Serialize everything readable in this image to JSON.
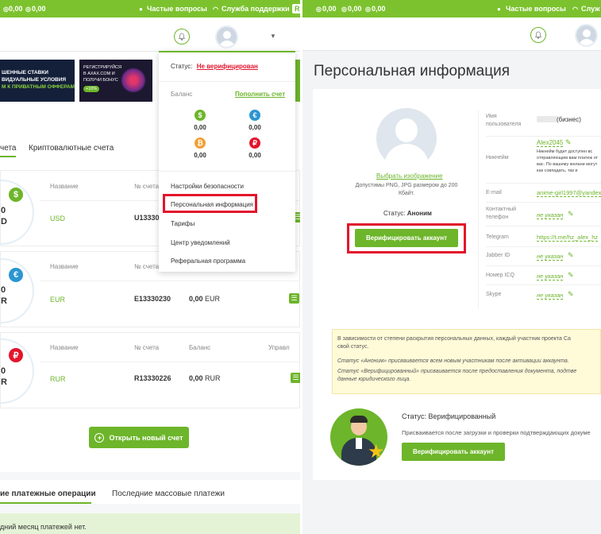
{
  "left": {
    "topbar": {
      "amount1": "0,00",
      "amount2": "0,00",
      "faq": "Частые вопросы",
      "support": "Служба поддержки",
      "lang": "R"
    },
    "banners": {
      "b1_line1": "ШЕННЫЕ СТАВКИ",
      "b1_line2": "ВИДУАЛЬНЫЕ УСЛОВИЯ",
      "b1_line3": "М К ПРИВАТНЫМ ОФФЕРАМ",
      "b2_line1": "РЕГИСТРИРУЙСЯ",
      "b2_line2": "В AXAX.COM И",
      "b2_line3": "ПОЛУЧИ БОНУС",
      "b2_badge": "+10%"
    },
    "tabs": {
      "tab1": "чета",
      "tab2": "Криптовалютные счета"
    },
    "accounts": [
      {
        "symbol": "$",
        "color": "#6db52a",
        "name_label": "Название",
        "acc_label": "№ счета",
        "name": "USD",
        "number": "U13330",
        "balance": "",
        "balance_label": "",
        "side1": "0",
        "side2": "D"
      },
      {
        "symbol": "€",
        "color": "#2b96d1",
        "name_label": "Название",
        "acc_label": "№ счета",
        "name": "EUR",
        "number": "E13330230",
        "balance": "0,00",
        "balance_label": "",
        "currency": "EUR",
        "side1": "0",
        "side2": "R"
      },
      {
        "symbol": "₽",
        "color": "#e2152c",
        "name_label": "Название",
        "acc_label": "№ счета",
        "name": "RUR",
        "number": "R13330226",
        "balance": "0,00",
        "balance_label": "Баланс",
        "currency": "RUR",
        "manage_label": "Управл",
        "side1": "0",
        "side2": "R"
      }
    ],
    "open_account": "Открыть новый счет",
    "bottom_tabs": {
      "tab1": "ие платежные операции",
      "tab2": "Последние массовые платежи"
    },
    "notice": "дний месяц платежей нет.",
    "dropdown": {
      "status_label": "Статус:",
      "status_value": "Не верифицирован",
      "balance_label": "Баланс",
      "topup": "Пополнить счет",
      "balances": [
        {
          "symbol": "$",
          "color": "#6db52a",
          "value": "0,00"
        },
        {
          "symbol": "€",
          "color": "#2b96d1",
          "value": "0,00"
        },
        {
          "symbol": "₿",
          "color": "#f3a034",
          "value": "0,00"
        },
        {
          "symbol": "₽",
          "color": "#e2152c",
          "value": "0,00"
        }
      ],
      "menu": [
        "Настройки безопасности",
        "Персональная информация",
        "Тарифы",
        "Центр уведомлений",
        "Реферальная программа"
      ]
    }
  },
  "right": {
    "topbar": {
      "a1": "0,00",
      "a2": "0,00",
      "a3": "0,00",
      "faq": "Частые вопросы",
      "support": "Служ"
    },
    "title": "Персональная информация",
    "choose_image": "Выбрать изображение",
    "formats": "Допустимы PNG, JPG размером до 200 Кбайт.",
    "status_label": "Статус:",
    "status_value": "Аноним",
    "verify": "Верифицировать аккаунт",
    "fields": [
      {
        "label": "Имя пользователя",
        "value": "(бизнес)"
      },
      {
        "label": "Никнейм",
        "value": "Alex2045",
        "note": "Никнейм будет доступен вс отправляющим вам платеж от вас. По вашему желани могут как совпадать, так и"
      },
      {
        "label": "E-mail",
        "value": "anime-girl1997@yandex.r"
      },
      {
        "label": "Контактный телефон",
        "value": "не указан"
      },
      {
        "label": "Telegram",
        "value": "https://t.me/hz_alex_hz"
      },
      {
        "label": "Jabber ID",
        "value": "не указан"
      },
      {
        "label": "Номер ICQ",
        "value": "не указан"
      },
      {
        "label": "Skype",
        "value": "не указан"
      }
    ],
    "info_line1": "В зависимости от степени раскрытия персональных данных, каждый участник проекта Са",
    "info_line2": "свой статус.",
    "info_anon": "Статус «Аноним» присваивается всем новым участникам после активации аккаунта.",
    "info_ver1": "Статус «Верифицированный» присваивается после предоставления документа, подтве",
    "info_ver2": "данные юридического лица.",
    "verified_title": "Статус: Верифицированный",
    "verified_desc": "Присваивается после загрузки и проверки подтверждающих докуме",
    "verify2": "Верифицировать аккаунт"
  }
}
